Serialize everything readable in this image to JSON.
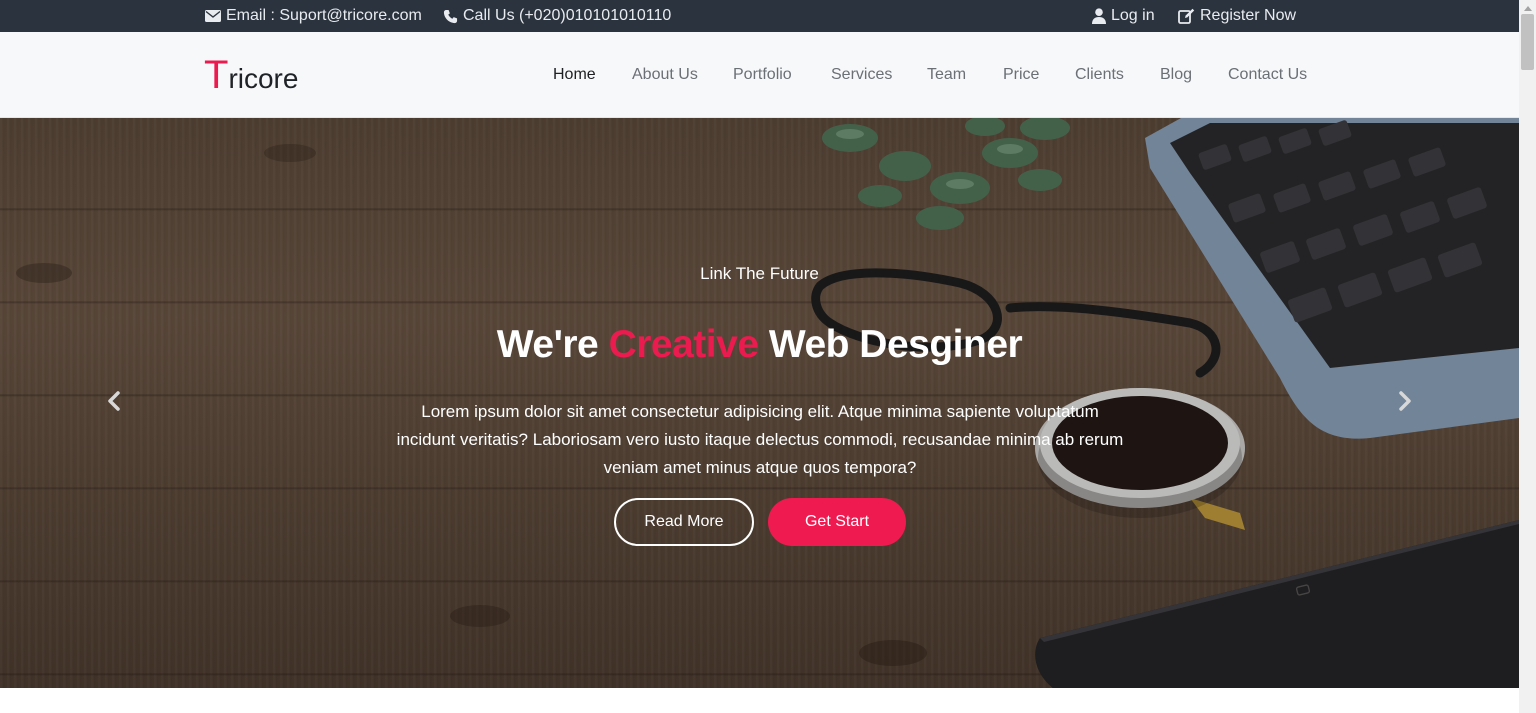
{
  "topbar": {
    "email": "Email : Suport@tricore.com",
    "phone": "Call Us (+020)010101010110",
    "login": "Log in",
    "register": "Register Now"
  },
  "brand": {
    "first_letter": "T",
    "rest": "ricore",
    "accent_color": "#eb1a4f"
  },
  "nav": {
    "items": [
      {
        "label": "Home",
        "active": true
      },
      {
        "label": "About Us"
      },
      {
        "label": "Portfolio"
      },
      {
        "label": "Services"
      },
      {
        "label": "Team"
      },
      {
        "label": "Price"
      },
      {
        "label": "Clients"
      },
      {
        "label": "Blog"
      },
      {
        "label": "Contact Us"
      }
    ]
  },
  "hero": {
    "subtitle": "Link The Future",
    "title_before": "We're ",
    "title_accent": "Creative",
    "title_after": " Web Desginer",
    "text": "Lorem ipsum dolor sit amet consectetur adipisicing elit. Atque minima sapiente voluptatum incidunt veritatis? Laboriosam vero iusto itaque delectus commodi, recusandae minima ab rerum veniam amet minus atque quos tempora?",
    "read_more": "Read More",
    "get_start": "Get Start"
  },
  "icons": {
    "email": "envelope-icon",
    "phone": "phone-icon",
    "login": "user-icon",
    "register": "edit-icon",
    "prev": "chevron-left-icon",
    "next": "chevron-right-icon"
  }
}
